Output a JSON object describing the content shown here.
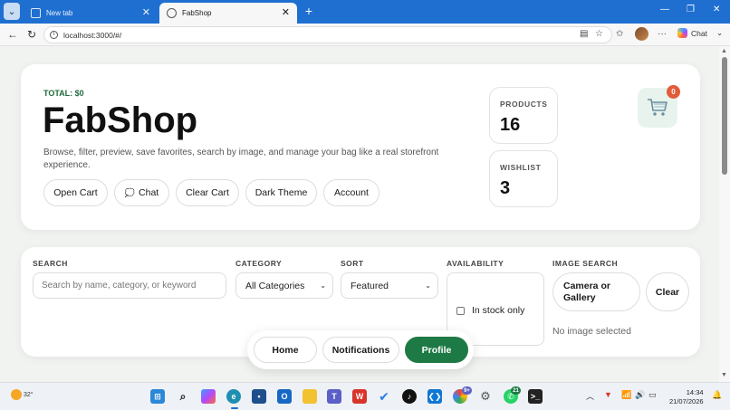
{
  "browser": {
    "tabs": [
      {
        "title": "New tab",
        "active": false
      },
      {
        "title": "FabShop",
        "active": true
      }
    ],
    "url": "localhost:3000/#/",
    "chat_label": "Chat"
  },
  "hero": {
    "total": "TOTAL: $0",
    "brand": "FabShop",
    "description": "Browse, filter, preview, save favorites, search by image, and manage your bag like a real storefront experience.",
    "buttons": {
      "open_cart": "Open Cart",
      "chat": "Chat",
      "clear_cart": "Clear Cart",
      "dark_theme": "Dark Theme",
      "account": "Account"
    },
    "stats": {
      "products_label": "PRODUCTS",
      "products_value": "16",
      "wishlist_label": "WISHLIST",
      "wishlist_value": "3"
    },
    "cart_count": "0"
  },
  "filters": {
    "search_label": "SEARCH",
    "search_placeholder": "Search by name, category, or keyword",
    "category_label": "CATEGORY",
    "category_value": "All Categories",
    "sort_label": "SORT",
    "sort_value": "Featured",
    "availability_label": "AVAILABILITY",
    "in_stock_label": "In stock only",
    "image_search_label": "IMAGE SEARCH",
    "camera_button": "Camera or Gallery",
    "clear_button": "Clear",
    "no_image": "No image selected"
  },
  "bottom_nav": {
    "home": "Home",
    "notifications": "Notifications",
    "profile": "Profile"
  },
  "taskbar": {
    "temperature": "32°",
    "time": "14:34",
    "date": "21/07/2026",
    "teams_badge": "9+",
    "whatsapp_badge": "21"
  },
  "colors": {
    "accent_green": "#1e7a45",
    "badge_red": "#e35b3b",
    "browser_blue": "#1f6fd1"
  }
}
